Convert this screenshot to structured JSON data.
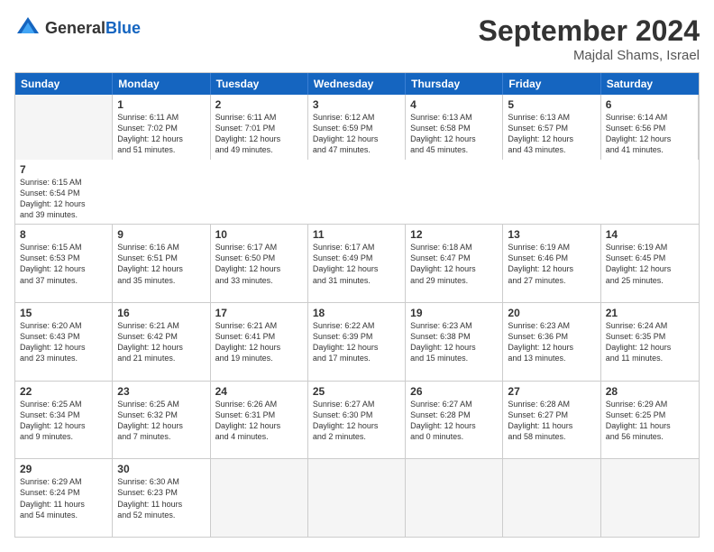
{
  "header": {
    "logo_general": "General",
    "logo_blue": "Blue",
    "month": "September 2024",
    "location": "Majdal Shams, Israel"
  },
  "days": [
    "Sunday",
    "Monday",
    "Tuesday",
    "Wednesday",
    "Thursday",
    "Friday",
    "Saturday"
  ],
  "rows": [
    [
      {
        "day": "",
        "empty": true
      },
      {
        "day": "1",
        "lines": [
          "Sunrise: 6:11 AM",
          "Sunset: 7:02 PM",
          "Daylight: 12 hours",
          "and 51 minutes."
        ]
      },
      {
        "day": "2",
        "lines": [
          "Sunrise: 6:11 AM",
          "Sunset: 7:01 PM",
          "Daylight: 12 hours",
          "and 49 minutes."
        ]
      },
      {
        "day": "3",
        "lines": [
          "Sunrise: 6:12 AM",
          "Sunset: 6:59 PM",
          "Daylight: 12 hours",
          "and 47 minutes."
        ]
      },
      {
        "day": "4",
        "lines": [
          "Sunrise: 6:13 AM",
          "Sunset: 6:58 PM",
          "Daylight: 12 hours",
          "and 45 minutes."
        ]
      },
      {
        "day": "5",
        "lines": [
          "Sunrise: 6:13 AM",
          "Sunset: 6:57 PM",
          "Daylight: 12 hours",
          "and 43 minutes."
        ]
      },
      {
        "day": "6",
        "lines": [
          "Sunrise: 6:14 AM",
          "Sunset: 6:56 PM",
          "Daylight: 12 hours",
          "and 41 minutes."
        ]
      },
      {
        "day": "7",
        "lines": [
          "Sunrise: 6:15 AM",
          "Sunset: 6:54 PM",
          "Daylight: 12 hours",
          "and 39 minutes."
        ]
      }
    ],
    [
      {
        "day": "8",
        "lines": [
          "Sunrise: 6:15 AM",
          "Sunset: 6:53 PM",
          "Daylight: 12 hours",
          "and 37 minutes."
        ]
      },
      {
        "day": "9",
        "lines": [
          "Sunrise: 6:16 AM",
          "Sunset: 6:51 PM",
          "Daylight: 12 hours",
          "and 35 minutes."
        ]
      },
      {
        "day": "10",
        "lines": [
          "Sunrise: 6:17 AM",
          "Sunset: 6:50 PM",
          "Daylight: 12 hours",
          "and 33 minutes."
        ]
      },
      {
        "day": "11",
        "lines": [
          "Sunrise: 6:17 AM",
          "Sunset: 6:49 PM",
          "Daylight: 12 hours",
          "and 31 minutes."
        ]
      },
      {
        "day": "12",
        "lines": [
          "Sunrise: 6:18 AM",
          "Sunset: 6:47 PM",
          "Daylight: 12 hours",
          "and 29 minutes."
        ]
      },
      {
        "day": "13",
        "lines": [
          "Sunrise: 6:19 AM",
          "Sunset: 6:46 PM",
          "Daylight: 12 hours",
          "and 27 minutes."
        ]
      },
      {
        "day": "14",
        "lines": [
          "Sunrise: 6:19 AM",
          "Sunset: 6:45 PM",
          "Daylight: 12 hours",
          "and 25 minutes."
        ]
      }
    ],
    [
      {
        "day": "15",
        "lines": [
          "Sunrise: 6:20 AM",
          "Sunset: 6:43 PM",
          "Daylight: 12 hours",
          "and 23 minutes."
        ]
      },
      {
        "day": "16",
        "lines": [
          "Sunrise: 6:21 AM",
          "Sunset: 6:42 PM",
          "Daylight: 12 hours",
          "and 21 minutes."
        ]
      },
      {
        "day": "17",
        "lines": [
          "Sunrise: 6:21 AM",
          "Sunset: 6:41 PM",
          "Daylight: 12 hours",
          "and 19 minutes."
        ]
      },
      {
        "day": "18",
        "lines": [
          "Sunrise: 6:22 AM",
          "Sunset: 6:39 PM",
          "Daylight: 12 hours",
          "and 17 minutes."
        ]
      },
      {
        "day": "19",
        "lines": [
          "Sunrise: 6:23 AM",
          "Sunset: 6:38 PM",
          "Daylight: 12 hours",
          "and 15 minutes."
        ]
      },
      {
        "day": "20",
        "lines": [
          "Sunrise: 6:23 AM",
          "Sunset: 6:36 PM",
          "Daylight: 12 hours",
          "and 13 minutes."
        ]
      },
      {
        "day": "21",
        "lines": [
          "Sunrise: 6:24 AM",
          "Sunset: 6:35 PM",
          "Daylight: 12 hours",
          "and 11 minutes."
        ]
      }
    ],
    [
      {
        "day": "22",
        "lines": [
          "Sunrise: 6:25 AM",
          "Sunset: 6:34 PM",
          "Daylight: 12 hours",
          "and 9 minutes."
        ]
      },
      {
        "day": "23",
        "lines": [
          "Sunrise: 6:25 AM",
          "Sunset: 6:32 PM",
          "Daylight: 12 hours",
          "and 7 minutes."
        ]
      },
      {
        "day": "24",
        "lines": [
          "Sunrise: 6:26 AM",
          "Sunset: 6:31 PM",
          "Daylight: 12 hours",
          "and 4 minutes."
        ]
      },
      {
        "day": "25",
        "lines": [
          "Sunrise: 6:27 AM",
          "Sunset: 6:30 PM",
          "Daylight: 12 hours",
          "and 2 minutes."
        ]
      },
      {
        "day": "26",
        "lines": [
          "Sunrise: 6:27 AM",
          "Sunset: 6:28 PM",
          "Daylight: 12 hours",
          "and 0 minutes."
        ]
      },
      {
        "day": "27",
        "lines": [
          "Sunrise: 6:28 AM",
          "Sunset: 6:27 PM",
          "Daylight: 11 hours",
          "and 58 minutes."
        ]
      },
      {
        "day": "28",
        "lines": [
          "Sunrise: 6:29 AM",
          "Sunset: 6:25 PM",
          "Daylight: 11 hours",
          "and 56 minutes."
        ]
      }
    ],
    [
      {
        "day": "29",
        "lines": [
          "Sunrise: 6:29 AM",
          "Sunset: 6:24 PM",
          "Daylight: 11 hours",
          "and 54 minutes."
        ]
      },
      {
        "day": "30",
        "lines": [
          "Sunrise: 6:30 AM",
          "Sunset: 6:23 PM",
          "Daylight: 11 hours",
          "and 52 minutes."
        ]
      },
      {
        "day": "",
        "empty": true
      },
      {
        "day": "",
        "empty": true
      },
      {
        "day": "",
        "empty": true
      },
      {
        "day": "",
        "empty": true
      },
      {
        "day": "",
        "empty": true
      }
    ]
  ]
}
